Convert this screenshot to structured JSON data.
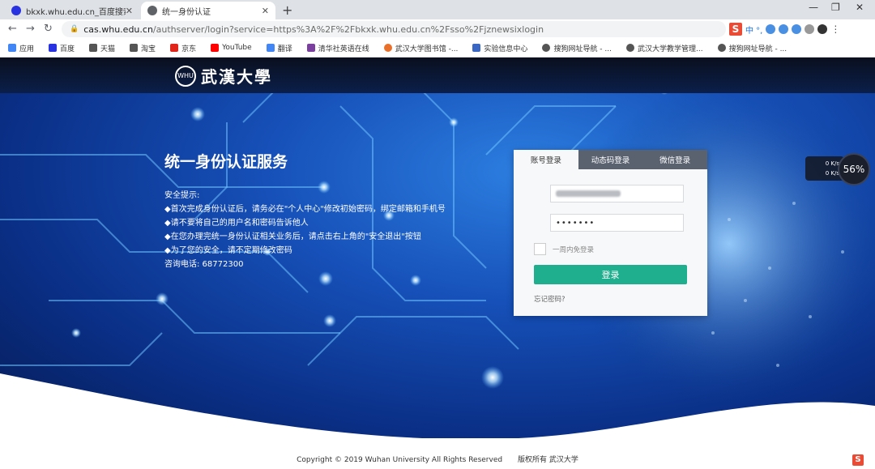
{
  "browser": {
    "tabs": [
      {
        "title": "bkxk.whu.edu.cn_百度搜索",
        "active": false
      },
      {
        "title": "统一身份认证",
        "active": true
      }
    ],
    "new_tab_glyph": "+",
    "url_host": "cas.whu.edu.cn",
    "url_path": "/authserver/login?service=https%3A%2F%2Fbkxk.whu.edu.cn%2Fsso%2Fjznewsixlogin",
    "bookmarks": [
      {
        "label": "应用",
        "color": "#4285f4"
      },
      {
        "label": "百度",
        "color": "#2932e1"
      },
      {
        "label": "天猫",
        "color": "#555555"
      },
      {
        "label": "淘宝",
        "color": "#555555"
      },
      {
        "label": "京东",
        "color": "#e1251b"
      },
      {
        "label": "YouTube",
        "color": "#ff0000"
      },
      {
        "label": "翻译",
        "color": "#4285f4"
      },
      {
        "label": "清华社英语在线",
        "color": "#7b3fa0"
      },
      {
        "label": "武汉大学图书馆 -...",
        "color": "#e8702a"
      },
      {
        "label": "实验信息中心",
        "color": "#3a66c4"
      },
      {
        "label": "搜狗网址导航 - ...",
        "color": "#555555"
      },
      {
        "label": "武汉大学教学管理...",
        "color": "#555555"
      },
      {
        "label": "搜狗网址导航 - ...",
        "color": "#555555"
      }
    ],
    "extension_text": "中 °,"
  },
  "header": {
    "seal_text": "WHU",
    "logo_text": "武漢大學"
  },
  "hero": {
    "headline": "统一身份认证服务",
    "tips_title": "安全提示:",
    "tips": [
      "◆首次完成身份认证后，请务必在\"个人中心\"修改初始密码，绑定邮箱和手机号",
      "◆请不要将自己的用户名和密码告诉他人",
      "◆在您办理完统一身份认证相关业务后，请点击右上角的\"安全退出\"按钮",
      "◆为了您的安全，请不定期修改密码"
    ],
    "phone": "咨询电话: 68772300"
  },
  "login": {
    "tabs": [
      "账号登录",
      "动态码登录",
      "微信登录"
    ],
    "password_value": "•••••••",
    "remember_label": "一周内免登录",
    "submit_label": "登录",
    "forgot_label": "忘记密码?"
  },
  "speed_widget": {
    "up": "0 K/s",
    "down": "0 K/s",
    "percent": "56%"
  },
  "footer": {
    "copyright": "Copyright © 2019 Wuhan  University All Rights Reserved",
    "rights": "版权所有  武汉大学"
  },
  "colors": {
    "accent_green": "#1fae8e",
    "hero_blue": "#1650b8"
  }
}
